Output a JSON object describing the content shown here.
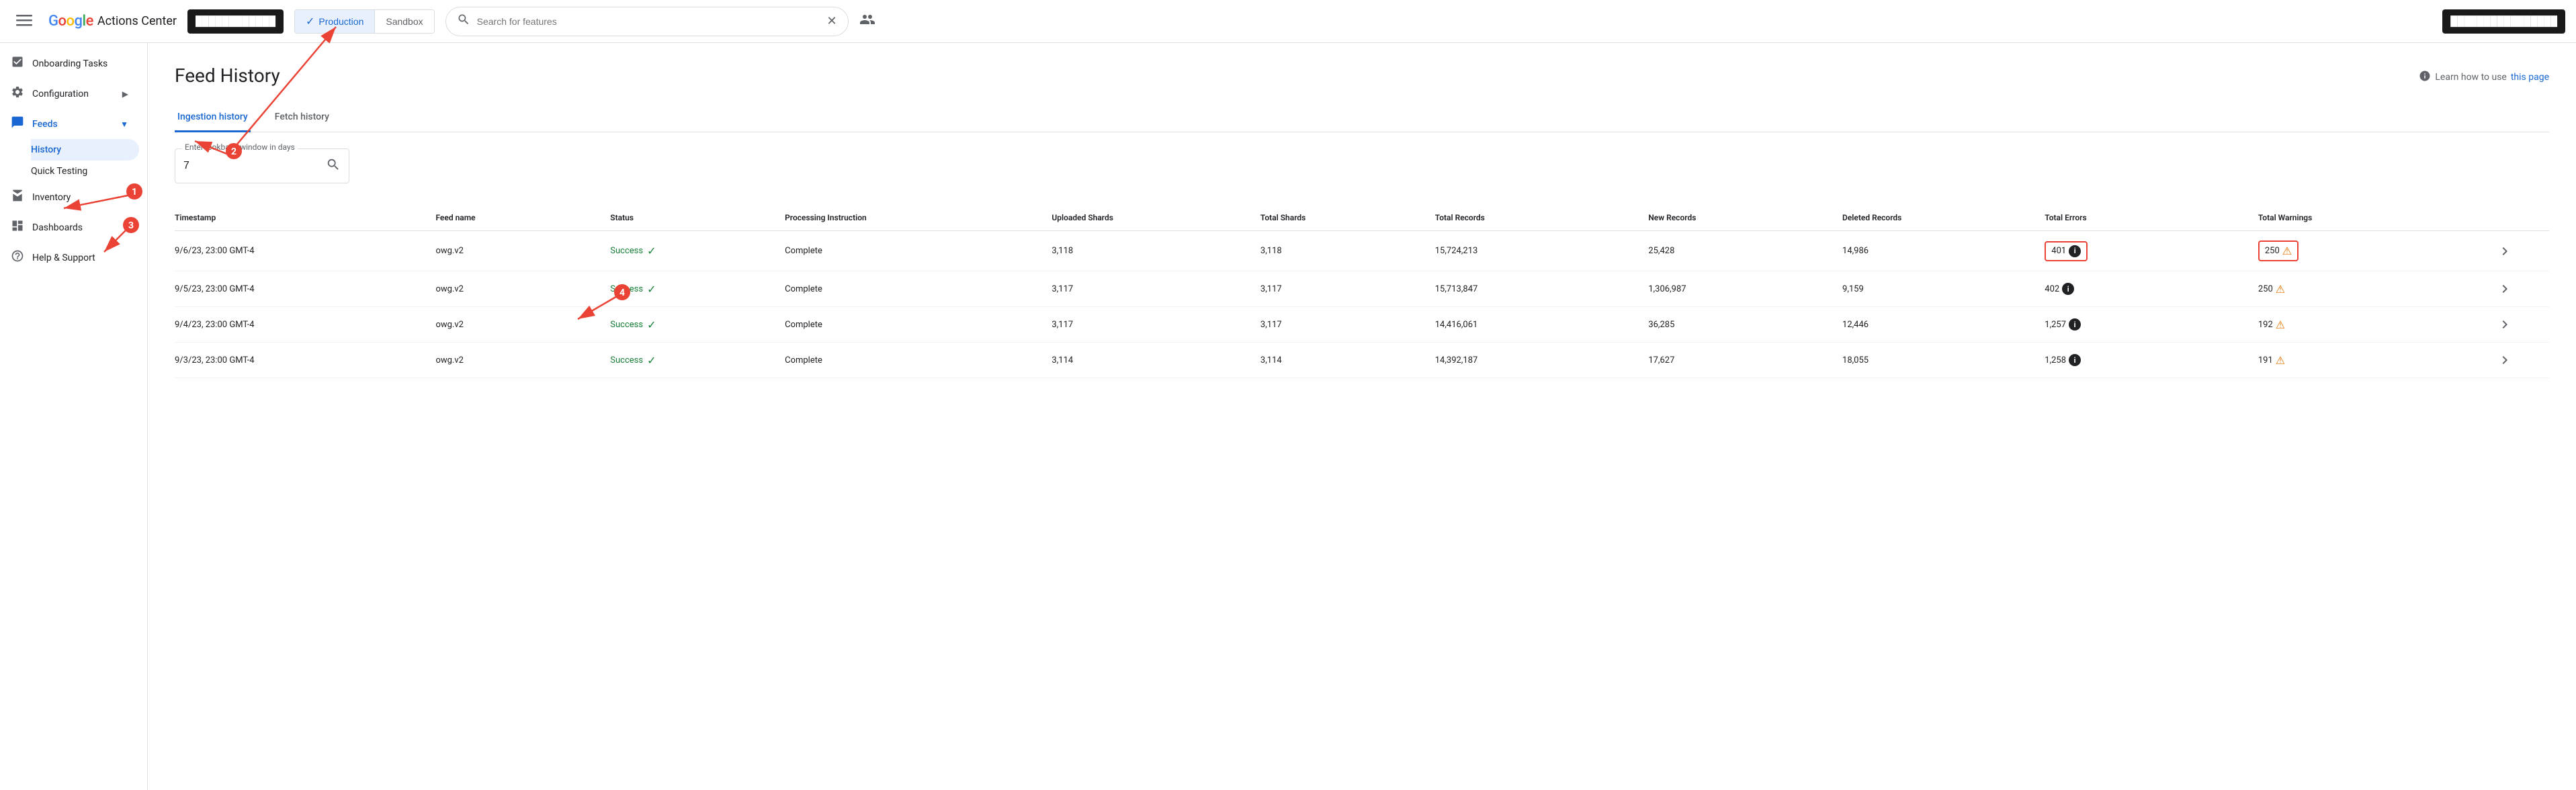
{
  "app": {
    "title": "Google Actions Center",
    "logo_google": "Google",
    "logo_text": "Actions Center"
  },
  "topbar": {
    "menu_label": "Menu",
    "account_block": "████████████",
    "env_production": "Production",
    "env_sandbox": "Sandbox",
    "search_placeholder": "Search for features",
    "user_icon": "👤",
    "right_block": "████████████████"
  },
  "sidebar": {
    "items": [
      {
        "id": "onboarding",
        "label": "Onboarding Tasks",
        "icon": "☑"
      },
      {
        "id": "configuration",
        "label": "Configuration",
        "icon": "⚙",
        "expandable": true
      },
      {
        "id": "feeds",
        "label": "Feeds",
        "icon": "▦",
        "expandable": true,
        "expanded": true
      },
      {
        "id": "inventory",
        "label": "Inventory",
        "icon": "▦"
      },
      {
        "id": "dashboards",
        "label": "Dashboards",
        "icon": "▦"
      },
      {
        "id": "help",
        "label": "Help & Support",
        "icon": "?"
      }
    ],
    "feeds_subitems": [
      {
        "id": "history",
        "label": "History",
        "active": true
      },
      {
        "id": "quick-testing",
        "label": "Quick Testing"
      }
    ]
  },
  "page": {
    "title": "Feed History",
    "learn_prefix": "Learn how to use",
    "learn_link_text": "this page"
  },
  "tabs": [
    {
      "id": "ingestion",
      "label": "Ingestion history",
      "active": true
    },
    {
      "id": "fetch",
      "label": "Fetch history",
      "active": false
    }
  ],
  "lookback": {
    "label": "Enter lookback window in days",
    "value": "7"
  },
  "table": {
    "headers": [
      "Timestamp",
      "Feed name",
      "Status",
      "Processing Instruction",
      "Uploaded Shards",
      "Total Shards",
      "Total Records",
      "New Records",
      "Deleted Records",
      "Total Errors",
      "Total Warnings",
      ""
    ],
    "rows": [
      {
        "timestamp": "9/6/23, 23:00 GMT-4",
        "feed_name": "owg.v2",
        "status": "Success",
        "processing_instruction": "Complete",
        "uploaded_shards": "3,118",
        "total_shards": "3,118",
        "total_records": "15,724,213",
        "new_records": "25,428",
        "deleted_records": "14,986",
        "total_errors": "401",
        "total_warnings": "250",
        "highlighted": true
      },
      {
        "timestamp": "9/5/23, 23:00 GMT-4",
        "feed_name": "owg.v2",
        "status": "Success",
        "processing_instruction": "Complete",
        "uploaded_shards": "3,117",
        "total_shards": "3,117",
        "total_records": "15,713,847",
        "new_records": "1,306,987",
        "deleted_records": "9,159",
        "total_errors": "402",
        "total_warnings": "250",
        "highlighted": false
      },
      {
        "timestamp": "9/4/23, 23:00 GMT-4",
        "feed_name": "owg.v2",
        "status": "Success",
        "processing_instruction": "Complete",
        "uploaded_shards": "3,117",
        "total_shards": "3,117",
        "total_records": "14,416,061",
        "new_records": "36,285",
        "deleted_records": "12,446",
        "total_errors": "1,257",
        "total_warnings": "192",
        "highlighted": false
      },
      {
        "timestamp": "9/3/23, 23:00 GMT-4",
        "feed_name": "owg.v2",
        "status": "Success",
        "processing_instruction": "Complete",
        "uploaded_shards": "3,114",
        "total_shards": "3,114",
        "total_records": "14,392,187",
        "new_records": "17,627",
        "deleted_records": "18,055",
        "total_errors": "1,258",
        "total_warnings": "191",
        "highlighted": false
      }
    ]
  },
  "annotations": [
    {
      "id": "1",
      "label": "1"
    },
    {
      "id": "2",
      "label": "2"
    },
    {
      "id": "3",
      "label": "3"
    },
    {
      "id": "4",
      "label": "4"
    }
  ]
}
